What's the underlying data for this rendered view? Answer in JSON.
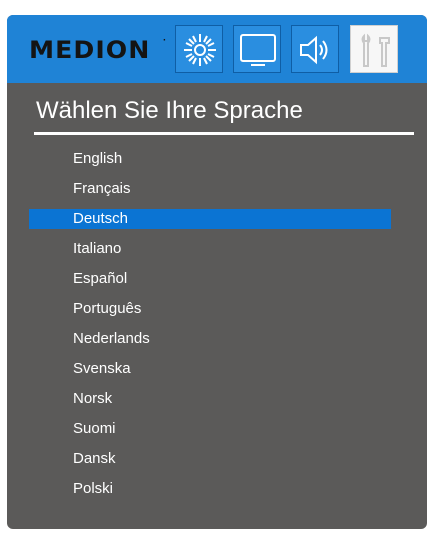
{
  "header": {
    "brand": "MEDION",
    "brand_mark": "·",
    "tabs": [
      {
        "icon": "brightness-icon",
        "active": false
      },
      {
        "icon": "screen-icon",
        "active": false
      },
      {
        "icon": "speaker-icon",
        "active": false
      },
      {
        "icon": "tools-icon",
        "active": true
      }
    ]
  },
  "menu": {
    "title": "Wählen Sie Ihre Sprache",
    "selected": "Deutsch",
    "languages": [
      "English",
      "Français",
      "Deutsch",
      "Italiano",
      "Español",
      "Português",
      "Nederlands",
      "Svenska",
      "Norsk",
      "Suomi",
      "Dansk",
      "Polski"
    ]
  },
  "colors": {
    "header_blue": "#1f83d6",
    "panel_gray": "#5b5a59",
    "selection_blue": "#0b74d3"
  }
}
